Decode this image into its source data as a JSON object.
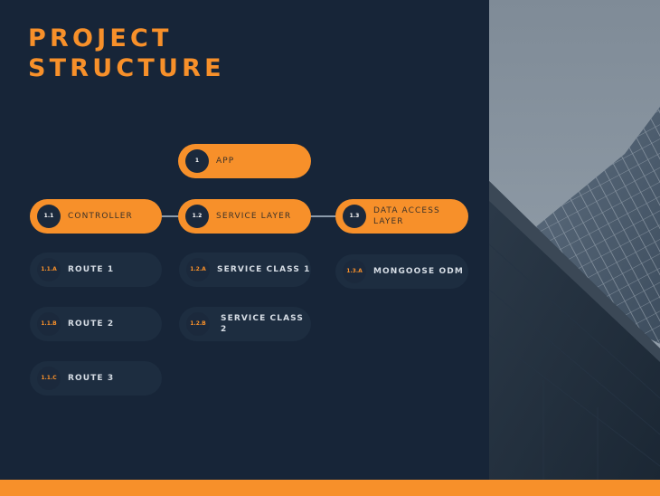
{
  "title": "PROJECT\nSTRUCTURE",
  "colors": {
    "background": "#172538",
    "accent": "#f7902a",
    "node_dark": "#1d2d40",
    "connector": "#8b9bab"
  },
  "diagram": {
    "root": {
      "number": "1",
      "label": "APP"
    },
    "level1": [
      {
        "number": "1.1",
        "label": "CONTROLLER"
      },
      {
        "number": "1.2",
        "label": "SERVICE LAYER"
      },
      {
        "number": "1.3",
        "label": "DATA ACCESS\nLAYER"
      }
    ],
    "controller_children": [
      {
        "number": "1.1.A",
        "label": "ROUTE 1"
      },
      {
        "number": "1.1.B",
        "label": "ROUTE 2"
      },
      {
        "number": "1.1.C",
        "label": "ROUTE 3"
      }
    ],
    "service_children": [
      {
        "number": "1.2.A",
        "label": "SERVICE CLASS 1"
      },
      {
        "number": "1.2.B",
        "label": "SERVICE CLASS 2"
      }
    ],
    "data_access_children": [
      {
        "number": "1.3.A",
        "label": "MONGOOSE ODM"
      }
    ]
  },
  "photo": {
    "subject": "building-facade-photo"
  }
}
